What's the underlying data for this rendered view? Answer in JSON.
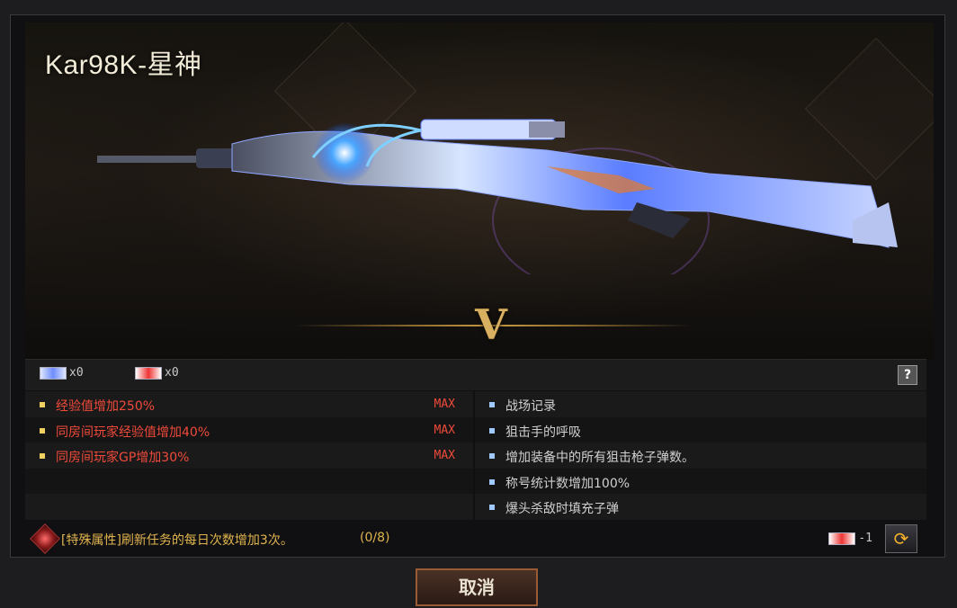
{
  "header": {
    "title": "Kar98K-星神"
  },
  "rank": {
    "label": "V"
  },
  "counts": [
    {
      "icon": "blue-ticket-icon",
      "value": "x0"
    },
    {
      "icon": "red-ticket-icon",
      "value": "x0"
    }
  ],
  "help_label": "?",
  "left_attributes": [
    {
      "label": "经验值增加250%",
      "max": "MAX"
    },
    {
      "label": "同房间玩家经验值增加40%",
      "max": "MAX"
    },
    {
      "label": "同房间玩家GP增加30%",
      "max": "MAX"
    }
  ],
  "right_attributes": [
    {
      "label": "战场记录"
    },
    {
      "label": "狙击手的呼吸"
    },
    {
      "label": "增加装备中的所有狙击枪子弹数。"
    },
    {
      "label": "称号统计数增加100%"
    },
    {
      "label": "爆头杀敌时填充子弹"
    }
  ],
  "special": {
    "text": "[特殊属性]刷新任务的每日次数增加3次。",
    "progress": "(0/8)"
  },
  "cost": {
    "icon": "red-ticket-icon",
    "value": "-1"
  },
  "cancel_label": "取消",
  "colors": {
    "attr_red": "#ef4a3a",
    "special_gold": "#e0b44e",
    "accent": "#9a5a33"
  }
}
